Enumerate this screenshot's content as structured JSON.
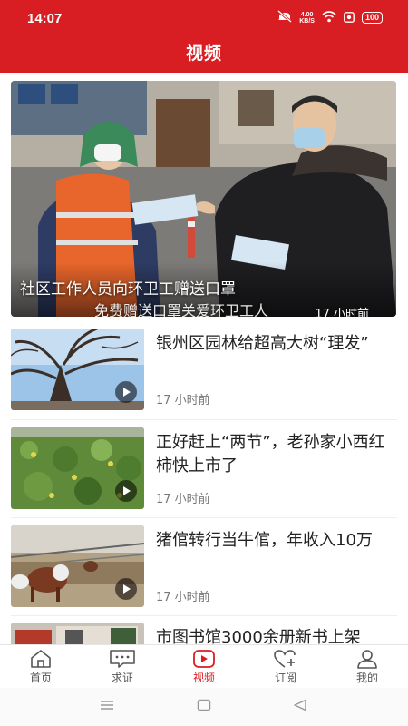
{
  "status_bar": {
    "time": "14:07",
    "net_speed_value": "4.00",
    "net_speed_unit": "KB/S",
    "battery": "100"
  },
  "header": {
    "title": "视频"
  },
  "hero": {
    "caption": "社区工作人员向环卫工赠送口罩",
    "subtitle": "免费赠送口罩关爱环卫工人",
    "time": "17 小时前"
  },
  "items": [
    {
      "title": "银州区园林给超高大树“理发”",
      "time": "17 小时前"
    },
    {
      "title": "正好赶上“两节”，老孙家小西红柿快上市了",
      "time": "17 小时前"
    },
    {
      "title": "猪倌转行当牛倌，年收入10万",
      "time": "17 小时前"
    },
    {
      "title": "市图书馆3000余册新书上架",
      "time": ""
    }
  ],
  "tabs": [
    {
      "label": "首页",
      "icon": "home-icon"
    },
    {
      "label": "求证",
      "icon": "chat-icon"
    },
    {
      "label": "视频",
      "icon": "video-icon",
      "active": true
    },
    {
      "label": "订阅",
      "icon": "heart-plus-icon"
    },
    {
      "label": "我的",
      "icon": "user-icon"
    }
  ],
  "colors": {
    "brand": "#d81e22",
    "text": "#222222",
    "meta": "#777777"
  }
}
